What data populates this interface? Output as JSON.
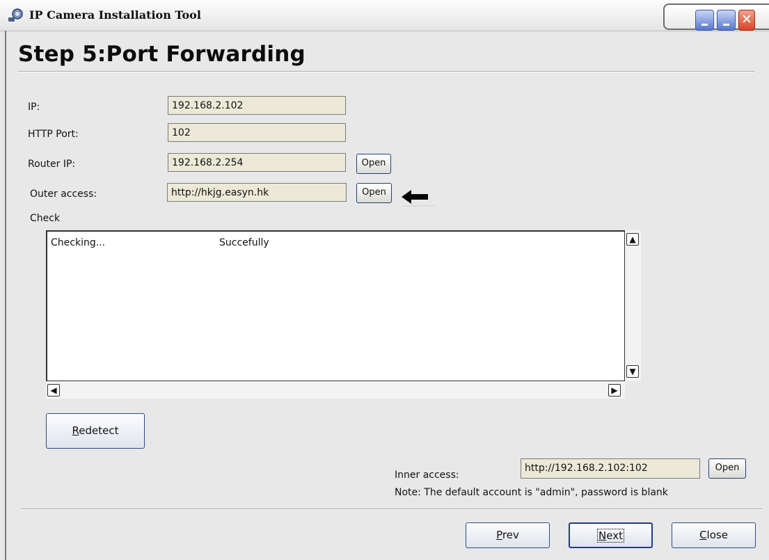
{
  "window": {
    "title": "IP Camera Installation Tool",
    "icons": {
      "app": "camera-app-icon",
      "minimize": "minimize-icon",
      "minimize2": "minimize-icon",
      "close": "close-icon"
    }
  },
  "page": {
    "heading": "Step 5:Port Forwarding"
  },
  "form": {
    "ip_label": "IP:",
    "ip_value": "192.168.2.102",
    "http_port_label": "HTTP Port:",
    "http_port_value": "102",
    "router_ip_label": "Router IP:",
    "router_ip_value": "192.168.2.254",
    "router_open_label": "Open",
    "outer_access_label": "Outer access:",
    "outer_access_value": "http://hkjg.easyn.hk",
    "outer_open_label": "Open",
    "arrow_icon": "arrow-left-icon"
  },
  "check": {
    "label": "Check",
    "rows": [
      {
        "status": "Checking...",
        "result": "Succefully"
      }
    ]
  },
  "buttons": {
    "redetect_mn": "R",
    "redetect_rest": "edetect",
    "prev_mn": "P",
    "prev_rest": "rev",
    "next_mn": "N",
    "next_rest": "ext",
    "close_mn": "C",
    "close_rest": "lose"
  },
  "inner": {
    "label": "Inner access:",
    "value": "http://192.168.2.102:102",
    "open_label": "Open",
    "note": "Note: The default account is \"admin\", password is blank"
  },
  "colors": {
    "background": "#e8e8e8",
    "field_bg": "#ece9d8",
    "button_border": "#2a4a8c",
    "close_button": "#d84527"
  }
}
